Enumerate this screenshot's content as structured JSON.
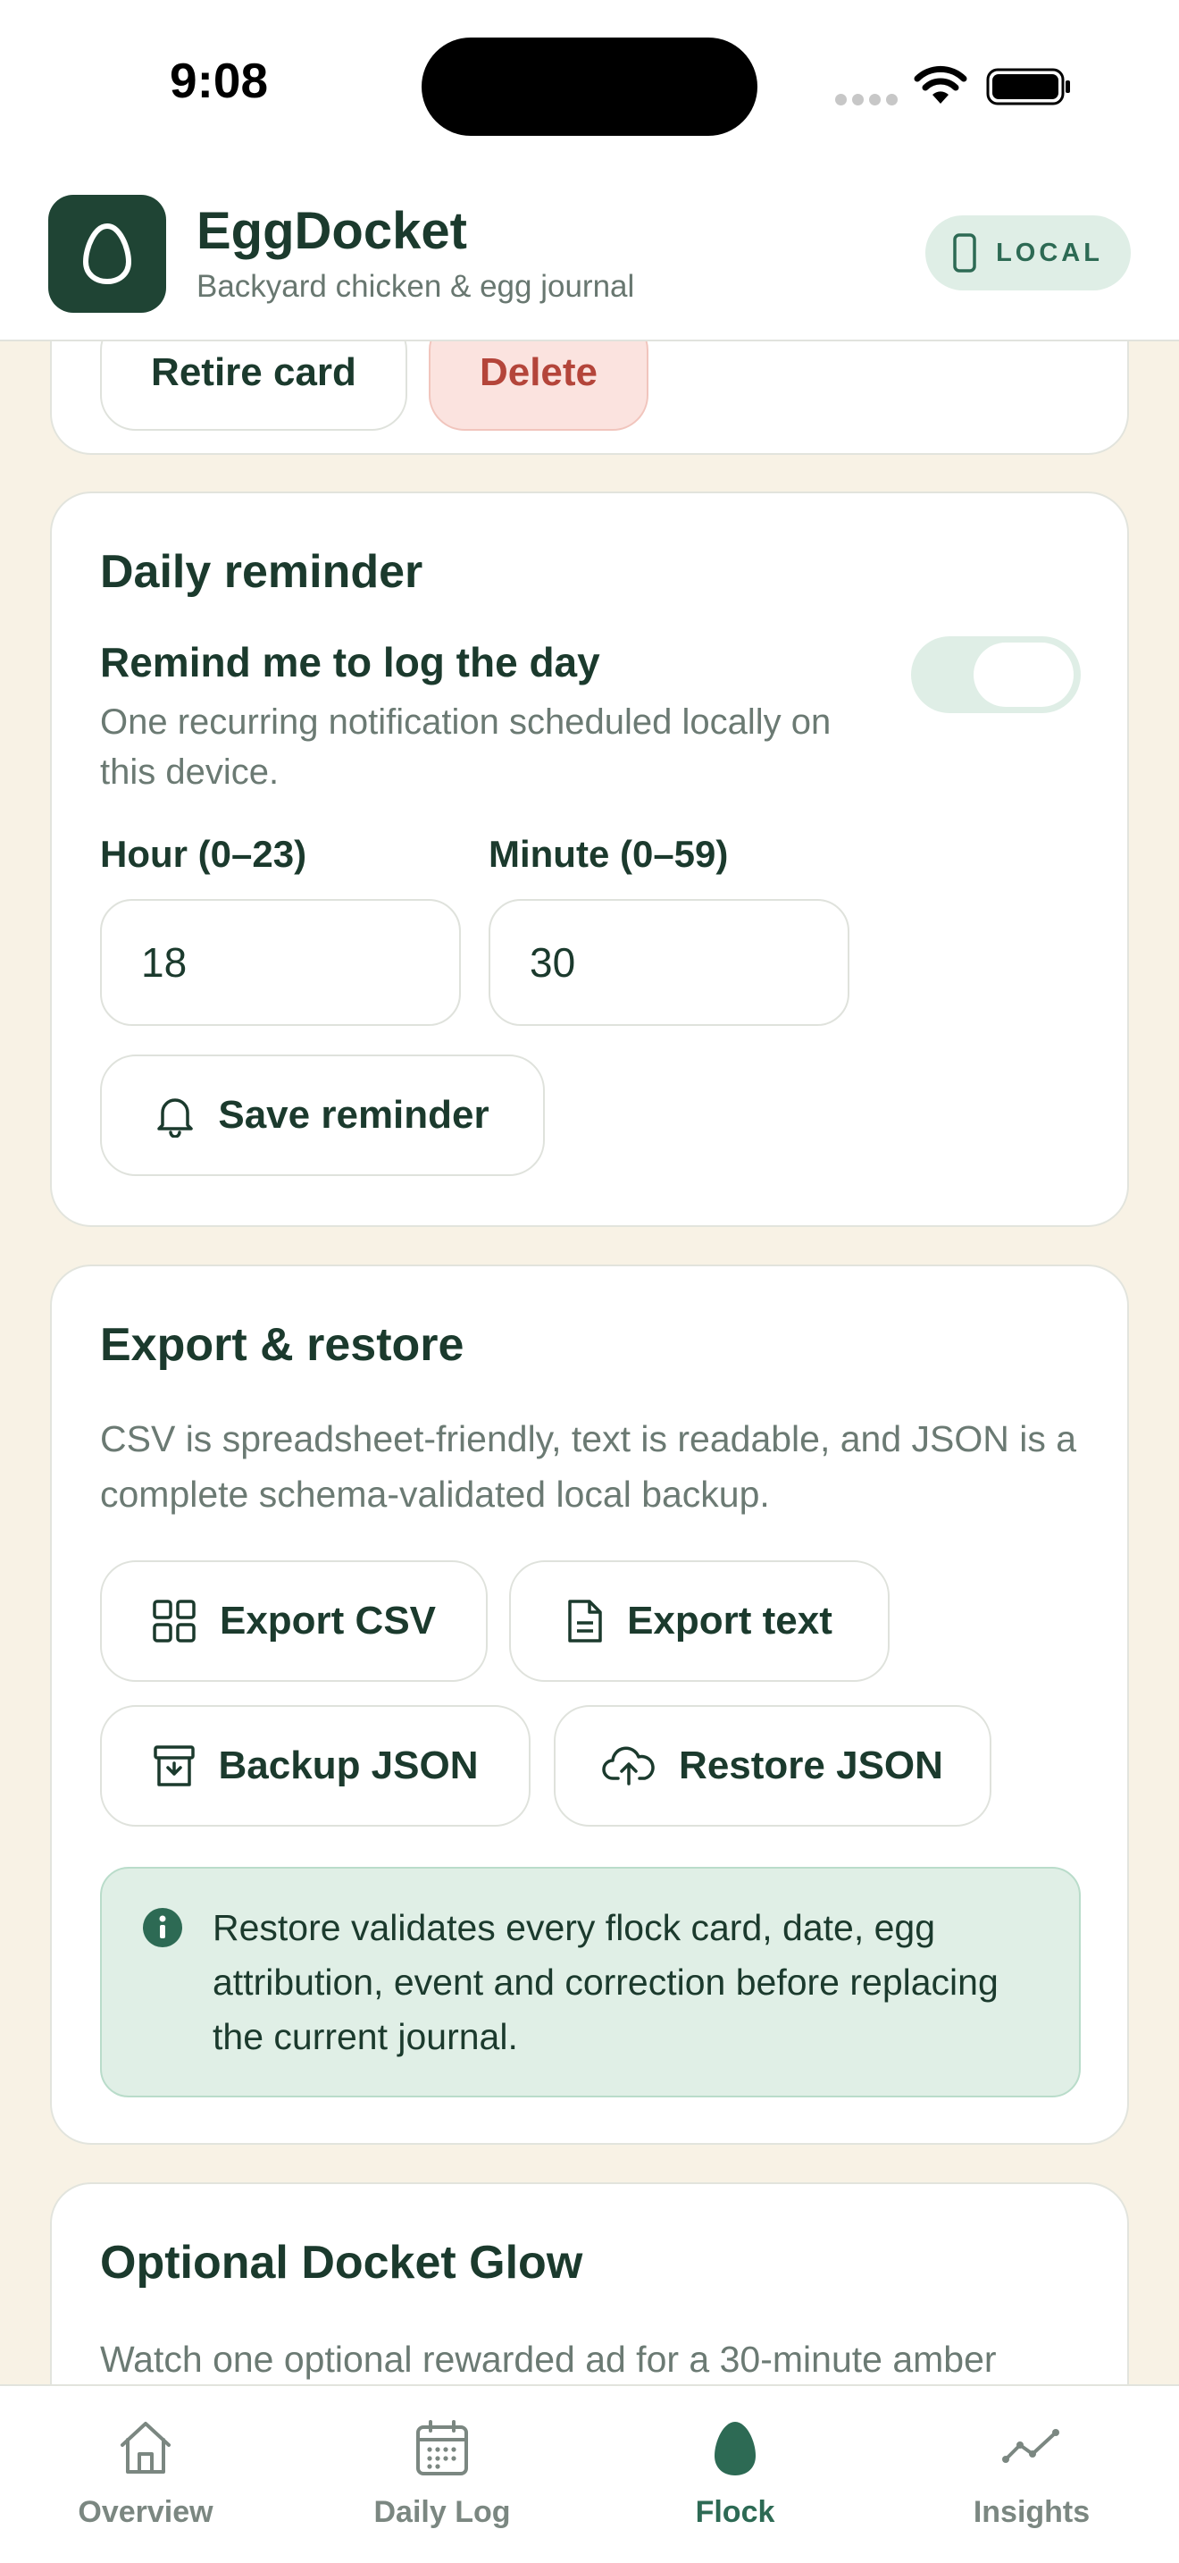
{
  "status_bar": {
    "time": "9:08"
  },
  "header": {
    "title": "EggDocket",
    "subtitle": "Backyard chicken & egg journal",
    "storage_badge": "LOCAL"
  },
  "card_actions": {
    "retire_label": "Retire card",
    "delete_label": "Delete"
  },
  "reminder": {
    "title": "Daily reminder",
    "toggle_title": "Remind me to log the day",
    "toggle_desc": "One recurring notification scheduled locally on this device.",
    "hour_label": "Hour (0–23)",
    "minute_label": "Minute (0–59)",
    "hour_value": "18",
    "minute_value": "30",
    "save_label": "Save reminder"
  },
  "export": {
    "title": "Export & restore",
    "description": "CSV is spreadsheet-friendly, text is readable, and JSON is a complete schema-validated local backup.",
    "export_csv": "Export CSV",
    "export_text": "Export text",
    "backup_json": "Backup JSON",
    "restore_json": "Restore JSON",
    "info": "Restore validates every flock card, date, egg attribution, event and correction before replacing the current journal."
  },
  "glow": {
    "title": "Optional Docket Glow",
    "description": "Watch one optional rewarded ad for a 30-minute amber"
  },
  "nav": {
    "tabs": [
      {
        "label": "Overview",
        "icon": "house-icon"
      },
      {
        "label": "Daily Log",
        "icon": "calendar-icon"
      },
      {
        "label": "Flock",
        "icon": "egg-icon"
      },
      {
        "label": "Insights",
        "icon": "trend-icon"
      }
    ],
    "active": "Flock"
  },
  "colors": {
    "brand": "#1f4434",
    "accent": "#2d6a54",
    "danger": "#b4453a",
    "background": "#f8f2e5"
  }
}
